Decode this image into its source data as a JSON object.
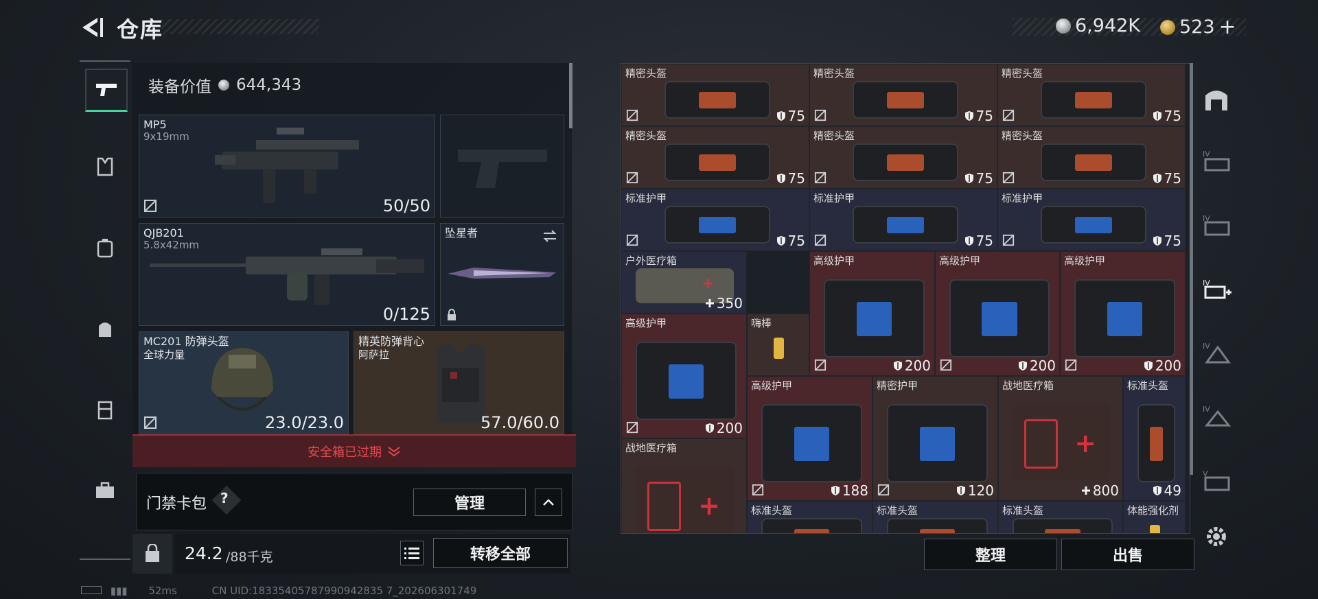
{
  "header": {
    "title": "仓库",
    "currency_silver": "6,942K",
    "currency_gold": "523",
    "plus_label": "+"
  },
  "equipment": {
    "value_label": "装备价值",
    "value": "644,343",
    "primary": {
      "name": "MP5",
      "caliber": "9x19mm",
      "ammo": "50/50"
    },
    "secondary": {
      "name": "QJB201",
      "caliber": "5.8x42mm",
      "ammo": "0/125"
    },
    "melee": {
      "name": "坠星者"
    },
    "helmet": {
      "name": "MC201 防弹头盔",
      "sub": "全球力量",
      "durability": "23.0/23.0"
    },
    "vest": {
      "name": "精英防弹背心",
      "sub": "阿萨拉",
      "durability": "57.0/60.0"
    }
  },
  "secure_box": {
    "expired_label": "安全箱已过期"
  },
  "card_pack": {
    "label": "门禁卡包",
    "help": "?",
    "manage": "管理"
  },
  "inventory": {
    "weight": "24.2",
    "capacity": "/88千克",
    "transfer_all": "转移全部"
  },
  "storage": {
    "items": [
      {
        "name": "精密头盔",
        "value": "75",
        "color": "brn"
      },
      {
        "name": "精密头盔",
        "value": "75",
        "color": "brn"
      },
      {
        "name": "精密头盔",
        "value": "75",
        "color": "brn"
      },
      {
        "name": "精密头盔",
        "value": "75",
        "color": "brn"
      },
      {
        "name": "精密头盔",
        "value": "75",
        "color": "brn"
      },
      {
        "name": "精密头盔",
        "value": "75",
        "color": "brn"
      },
      {
        "name": "标准护甲",
        "value": "75",
        "color": "blu"
      },
      {
        "name": "标准护甲",
        "value": "75",
        "color": "blu"
      },
      {
        "name": "标准护甲",
        "value": "75",
        "color": "blu"
      },
      {
        "name": "户外医疗箱",
        "value": "350",
        "color": "blu"
      },
      {
        "name": "高级护甲",
        "value": "200",
        "color": "red"
      },
      {
        "name": "高级护甲",
        "value": "200",
        "color": "red"
      },
      {
        "name": "高级护甲",
        "value": "200",
        "color": "red"
      },
      {
        "name": "高级护甲",
        "value": "200",
        "color": "red"
      },
      {
        "name": "嗨棒",
        "value": "",
        "color": "brn"
      },
      {
        "name": "高级护甲",
        "value": "188",
        "color": "red"
      },
      {
        "name": "精密护甲",
        "value": "120",
        "color": "brn"
      },
      {
        "name": "战地医疗箱",
        "value": "800",
        "color": "brn"
      },
      {
        "name": "标准头盔",
        "value": "49",
        "color": "blu"
      },
      {
        "name": "战地医疗箱",
        "value": "",
        "color": "brn"
      },
      {
        "name": "标准头盔",
        "value": "",
        "color": "blu"
      },
      {
        "name": "标准头盔",
        "value": "",
        "color": "blu"
      },
      {
        "name": "标准头盔",
        "value": "",
        "color": "blu"
      },
      {
        "name": "体能强化剂",
        "value": "",
        "color": "blu"
      }
    ],
    "sort_button": "整理",
    "sell_button": "出售"
  },
  "status": {
    "ping": "52ms",
    "uid": "CN UID:18335405787990942835 7_202606301749"
  }
}
